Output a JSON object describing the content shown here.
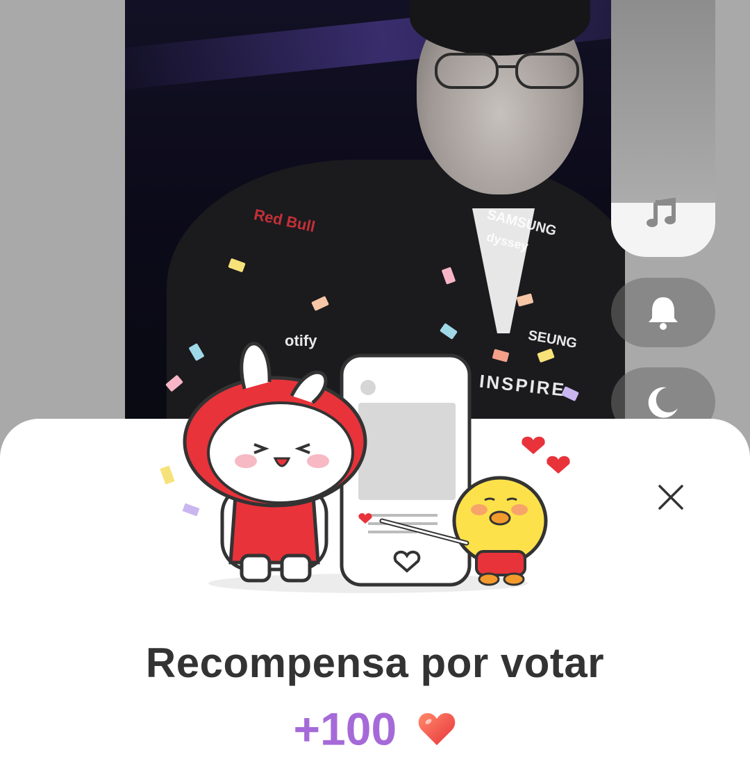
{
  "photo_patches": {
    "redbull": "Red Bull",
    "samsung": "SAMSUNG",
    "odyssey": "dyssey",
    "spotify": "otify",
    "seung": "SEUNG",
    "inspire": "INSPIRE"
  },
  "rail": {
    "music": "music-icon",
    "bell": "bell-icon",
    "moon": "moon-icon"
  },
  "modal": {
    "title": "Recompensa por votar",
    "reward_amount": "+100",
    "reward_icon": "heart-icon",
    "close": "close-icon"
  },
  "colors": {
    "accent_purple": "#a56ad8",
    "heart_red": "#f2555a",
    "title_text": "#333333"
  }
}
